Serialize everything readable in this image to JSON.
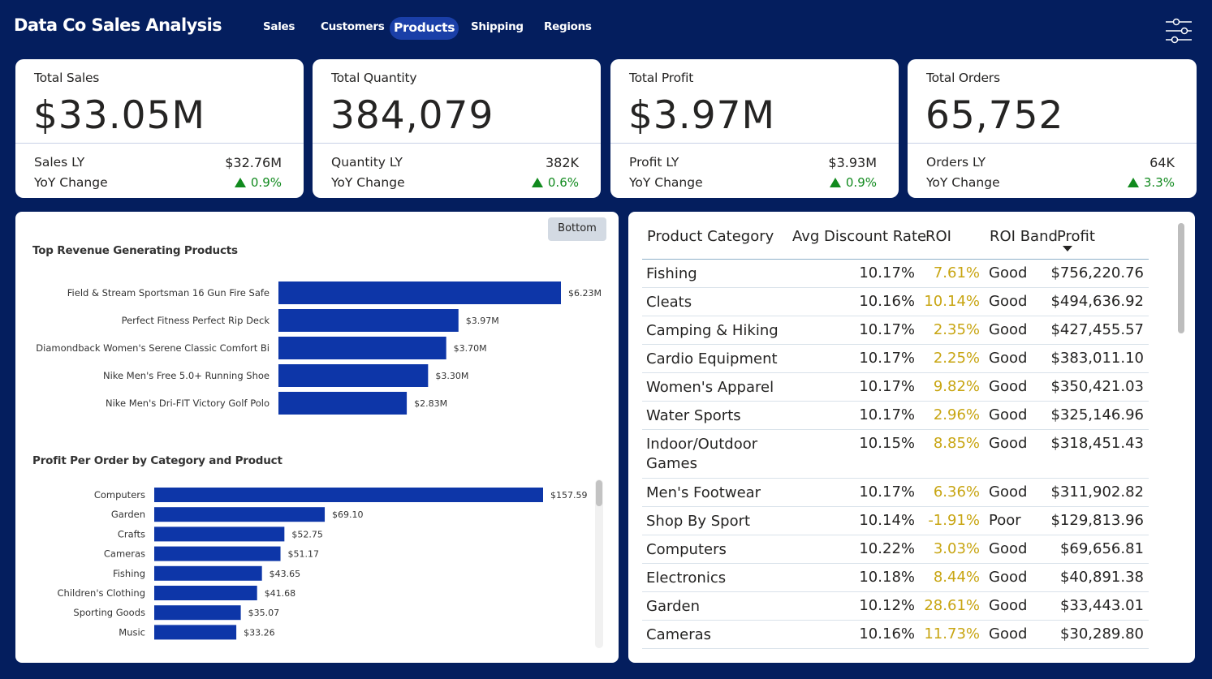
{
  "header": {
    "title": "Data Co Sales Analysis",
    "nav": [
      {
        "label": "Sales",
        "active": false
      },
      {
        "label": "Customers",
        "active": false
      },
      {
        "label": "Products",
        "active": true
      },
      {
        "label": "Shipping",
        "active": false
      },
      {
        "label": "Regions",
        "active": false
      }
    ],
    "filter_icon": "sliders-icon"
  },
  "kpis": [
    {
      "title": "Total Sales",
      "value": "$33.05M",
      "ly_label": "Sales LY",
      "ly_value": "$32.76M",
      "yoy_label": "YoY Change",
      "yoy_value": "0.9%",
      "trend": "up"
    },
    {
      "title": "Total Quantity",
      "value": "384,079",
      "ly_label": "Quantity LY",
      "ly_value": "382K",
      "yoy_label": "YoY Change",
      "yoy_value": "0.6%",
      "trend": "up"
    },
    {
      "title": "Total Profit",
      "value": "$3.97M",
      "ly_label": "Profit LY",
      "ly_value": "$3.93M",
      "yoy_label": "YoY Change",
      "yoy_value": "0.9%",
      "trend": "up"
    },
    {
      "title": "Total Orders",
      "value": "65,752",
      "ly_label": "Orders LY",
      "ly_value": "64K",
      "yoy_label": "YoY Change",
      "yoy_value": "3.3%",
      "trend": "up"
    }
  ],
  "colors": {
    "background": "#041e5e",
    "bar": "#0d36a8",
    "positive": "#118a1e",
    "roi": "#c8a512",
    "active_tab": "#1a3fa8"
  },
  "left_panel": {
    "toggle_label": "Bottom"
  },
  "chart_data": [
    {
      "type": "bar",
      "orientation": "horizontal",
      "title": "Top Revenue Generating Products",
      "categories": [
        "Field & Stream Sportsman 16 Gun Fire Safe",
        "Perfect Fitness Perfect Rip Deck",
        "Diamondback Women's Serene Classic Comfort Bi",
        "Nike Men's Free 5.0+ Running Shoe",
        "Nike Men's Dri-FIT Victory Golf Polo"
      ],
      "values": [
        6.23,
        3.97,
        3.7,
        3.3,
        2.83
      ],
      "data_labels": [
        "$6.23M",
        "$3.97M",
        "$3.70M",
        "$3.30M",
        "$2.83M"
      ],
      "xlim": [
        0,
        6.23
      ],
      "grid": false
    },
    {
      "type": "bar",
      "orientation": "horizontal",
      "title": "Profit Per Order by Category and Product",
      "categories": [
        "Computers",
        "Garden",
        "Crafts",
        "Cameras",
        "Fishing",
        "Children's Clothing",
        "Sporting Goods",
        "Music"
      ],
      "values": [
        157.59,
        69.1,
        52.75,
        51.17,
        43.65,
        41.68,
        35.07,
        33.26
      ],
      "data_labels": [
        "$157.59",
        "$69.10",
        "$52.75",
        "$51.17",
        "$43.65",
        "$41.68",
        "$35.07",
        "$33.26"
      ],
      "xlim": [
        0,
        157.59
      ],
      "grid": false
    }
  ],
  "table": {
    "columns": [
      "Product Category",
      "Avg Discount Rate",
      "ROI",
      "ROI Band",
      "Profit"
    ],
    "sort_column": "Profit",
    "sort_direction": "descending",
    "rows": [
      {
        "category": "Fishing",
        "discount": "10.17%",
        "roi": "7.61%",
        "band": "Good",
        "profit": "$756,220.76"
      },
      {
        "category": "Cleats",
        "discount": "10.16%",
        "roi": "10.14%",
        "band": "Good",
        "profit": "$494,636.92"
      },
      {
        "category": "Camping & Hiking",
        "discount": "10.17%",
        "roi": "2.35%",
        "band": "Good",
        "profit": "$427,455.57"
      },
      {
        "category": "Cardio Equipment",
        "discount": "10.17%",
        "roi": "2.25%",
        "band": "Good",
        "profit": "$383,011.10"
      },
      {
        "category": "Women's Apparel",
        "discount": "10.17%",
        "roi": "9.82%",
        "band": "Good",
        "profit": "$350,421.03"
      },
      {
        "category": "Water Sports",
        "discount": "10.17%",
        "roi": "2.96%",
        "band": "Good",
        "profit": "$325,146.96"
      },
      {
        "category": "Indoor/Outdoor Games",
        "discount": "10.15%",
        "roi": "8.85%",
        "band": "Good",
        "profit": "$318,451.43"
      },
      {
        "category": "Men's Footwear",
        "discount": "10.17%",
        "roi": "6.36%",
        "band": "Good",
        "profit": "$311,902.82"
      },
      {
        "category": "Shop By Sport",
        "discount": "10.14%",
        "roi": "-1.91%",
        "band": "Poor",
        "profit": "$129,813.96"
      },
      {
        "category": "Computers",
        "discount": "10.22%",
        "roi": "3.03%",
        "band": "Good",
        "profit": "$69,656.81"
      },
      {
        "category": "Electronics",
        "discount": "10.18%",
        "roi": "8.44%",
        "band": "Good",
        "profit": "$40,891.38"
      },
      {
        "category": "Garden",
        "discount": "10.12%",
        "roi": "28.61%",
        "band": "Good",
        "profit": "$33,443.01"
      },
      {
        "category": "Cameras",
        "discount": "10.16%",
        "roi": "11.73%",
        "band": "Good",
        "profit": "$30,289.80"
      }
    ]
  }
}
